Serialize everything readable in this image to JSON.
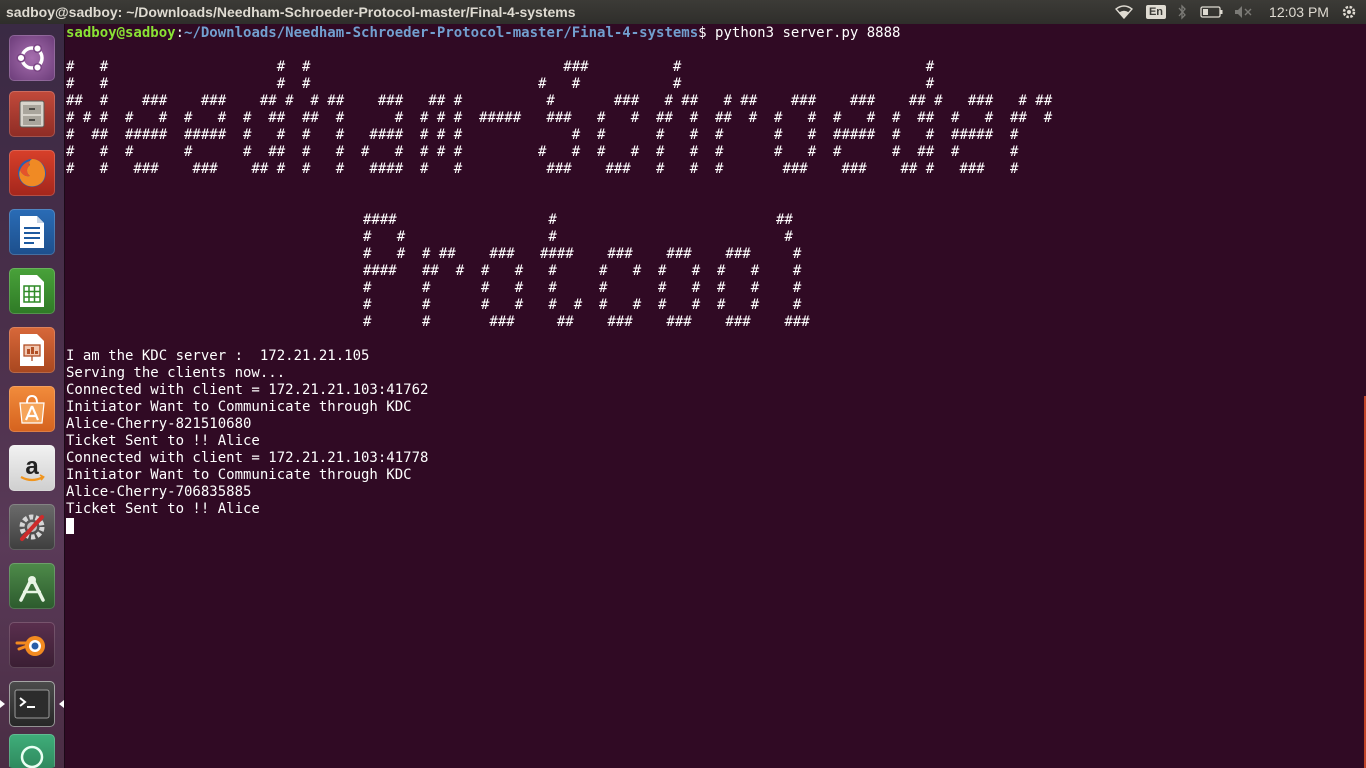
{
  "top_panel": {
    "window_title": "sadboy@sadboy: ~/Downloads/Needham-Schroeder-Protocol-master/Final-4-systems",
    "keyboard_layout": "En",
    "clock": "12:03 PM"
  },
  "launcher": {
    "items": [
      {
        "name": "ubuntu-dash",
        "icon": "ubuntu-logo-icon"
      },
      {
        "name": "files",
        "icon": "file-cabinet-icon"
      },
      {
        "name": "firefox",
        "icon": "firefox-icon"
      },
      {
        "name": "libreoffice-writer",
        "icon": "writer-document-icon"
      },
      {
        "name": "libreoffice-calc",
        "icon": "calc-spreadsheet-icon"
      },
      {
        "name": "libreoffice-impress",
        "icon": "impress-presentation-icon"
      },
      {
        "name": "ubuntu-software",
        "icon": "software-bag-icon"
      },
      {
        "name": "amazon",
        "icon": "amazon-icon"
      },
      {
        "name": "system-settings",
        "icon": "settings-tools-icon"
      },
      {
        "name": "android-studio",
        "icon": "android-studio-icon"
      },
      {
        "name": "blender",
        "icon": "blender-icon"
      },
      {
        "name": "terminal",
        "icon": "terminal-icon"
      },
      {
        "name": "other-app",
        "icon": "app-icon"
      }
    ]
  },
  "terminal": {
    "prompt_user": "sadboy@sadboy",
    "prompt_path": "~/Downloads/Needham-Schroeder-Protocol-master/Final-4-systems",
    "command": "python3 server.py 8888",
    "banner_1": [
      "#   #                    #  #                              ###          #                             #",
      "#   #                    #  #                           #   #           #                             #",
      "##  #    ###    ###    ## #  # ##    ###   ## #          #       ###   # ##   # ##    ###    ###    ## #   ###   # ##",
      "# # #  #   #  #   #  #  ##  ##  #      #  # # #  #####   ###   #   #  ##  #  ##  #  #   #  #   #  #  ##  #   #  ##  #",
      "#  ##  #####  #####  #   #  #   #   ####  # # #             #  #      #   #  #      #   #  #####  #   #  #####  #",
      "#   #  #      #      #  ##  #   #  #   #  # # #         #   #  #   #  #   #  #      #   #  #      #  ##  #      #",
      "#   #   ###    ###    ## #  #   #   ####  #   #          ###    ###   #   #  #       ###    ###    ## #   ###   #"
    ],
    "banner_2": [
      "####                  #                          ##",
      "#   #                 #                           #",
      "#   #  # ##    ###   ####    ###    ###    ###     #",
      "####   ##  #  #   #   #     #   #  #   #  #   #    #",
      "#      #      #   #   #     #      #   #  #   #    #",
      "#      #      #   #   #  #  #   #  #   #  #   #    #",
      "#      #       ###     ##    ###    ###    ###    ###"
    ],
    "output_lines": [
      "I am the KDC server :  172.21.21.105",
      "Serving the clients now...",
      "Connected with client = 172.21.21.103:41762",
      "Initiator Want to Communicate through KDC",
      "Alice-Cherry-821510680",
      "Ticket Sent to !! Alice",
      "Connected with client = 172.21.21.103:41778",
      "Initiator Want to Communicate through KDC",
      "Alice-Cherry-706835885",
      "Ticket Sent to !! Alice"
    ]
  },
  "colors": {
    "terminal_background": "#300a24",
    "prompt_user": "#8ae234",
    "prompt_path": "#729fcf",
    "text": "#ffffff",
    "panel": "#3c3b37"
  }
}
